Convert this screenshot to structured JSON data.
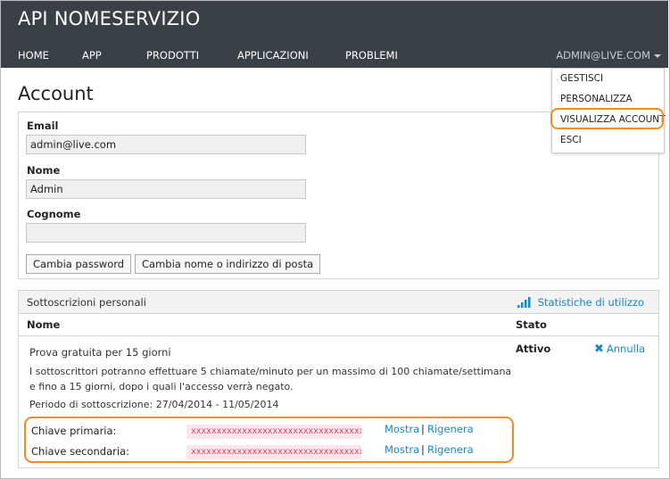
{
  "app": {
    "title": "API NOMESERVIZIO"
  },
  "nav": {
    "items": [
      "HOME",
      "APP",
      "PRODOTTI",
      "APPLICAZIONI",
      "PROBLEMI"
    ],
    "user": "ADMIN@LIVE.COM"
  },
  "user_dropdown": {
    "items": [
      "GESTISCI",
      "PERSONALIZZA",
      "VISUALIZZA ACCOUNT",
      "ESCI"
    ],
    "highlighted": "VISUALIZZA ACCOUNT"
  },
  "page": {
    "title": "Account"
  },
  "account": {
    "email_label": "Email",
    "email_value": "admin@live.com",
    "first_name_label": "Nome",
    "first_name_value": "Admin",
    "last_name_label": "Cognome",
    "last_name_value": "",
    "change_password_button": "Cambia password",
    "change_name_button": "Cambia nome o indirizzo di posta"
  },
  "subscriptions": {
    "title": "Sottoscrizioni personali",
    "usage_link": "Statistiche di utilizzo",
    "col_name": "Nome",
    "col_status": "Stato",
    "plan_name": "Prova gratuita per 15 giorni",
    "status": "Attivo",
    "cancel_label": "Annulla",
    "description": "I sottoscrittori potranno effettuare 5 chiamate/minuto per un massimo di 100 chiamate/settimana e fino a 15 giorni, dopo i quali l'accesso verrà negato.",
    "period": "Periodo di sottoscrizione: 27/04/2014 - 11/05/2014",
    "primary_key_label": "Chiave primaria:",
    "primary_key_value": "xxxxxxxxxxxxxxxxxxxxxxxxxxxxxxxxxx",
    "secondary_key_label": "Chiave secondaria:",
    "secondary_key_value": "xxxxxxxxxxxxxxxxxxxxxxxxxxxxxxxxxx",
    "show_label": "Mostra",
    "regenerate_label": "Rigenera",
    "separator": "|"
  },
  "colors": {
    "topbar": "#3b3f46",
    "accent_link": "#1a86c8",
    "highlight": "#f28c1e",
    "key_text": "#d43f67",
    "key_bg": "#fbe4ea"
  },
  "icons": {
    "usage": "bar-chart-icon",
    "cancel": "x-icon",
    "user_caret": "caret-down-icon"
  }
}
